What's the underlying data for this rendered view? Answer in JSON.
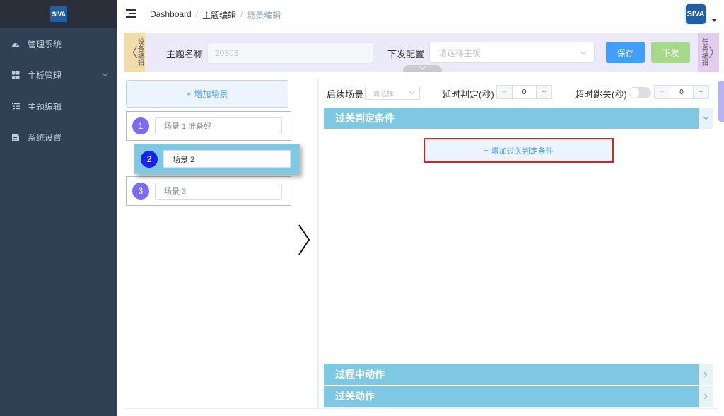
{
  "sidebar": {
    "logo_text": "SIVA",
    "items": [
      {
        "label": "管理系统",
        "icon": "dashboard-icon"
      },
      {
        "label": "主板管理",
        "icon": "grid-icon",
        "has_submenu": true
      },
      {
        "label": "主题编辑",
        "icon": "list-icon"
      },
      {
        "label": "系统设置",
        "icon": "document-icon"
      }
    ]
  },
  "navbar": {
    "breadcrumb": [
      "Dashboard",
      "主题编辑",
      "场景编辑"
    ],
    "avatar_text": "SIVA"
  },
  "theme_bar": {
    "left_tab": "设备编辑",
    "right_tab": "任务编辑",
    "theme_name_label": "主题名称",
    "theme_name_value": "20303",
    "config_label": "下发配置",
    "config_placeholder": "请选择主板",
    "save_label": "保存",
    "send_label": "下发"
  },
  "scenes": {
    "add_label": "增加场景",
    "items": [
      {
        "num": "1",
        "name": "场景 1 准备好",
        "color": "#7b6cf6"
      },
      {
        "num": "2",
        "name": "场景 2",
        "color": "#1a22f0"
      },
      {
        "num": "3",
        "name": "场景 3",
        "color": "#7b6cf6"
      }
    ]
  },
  "scene_settings": {
    "next_scene_label": "后续场景",
    "next_scene_placeholder": "请选择",
    "delay_label": "延时判定(秒)",
    "delay_value": "0",
    "timeout_label": "超时跳关(秒)",
    "timeout_value": "0",
    "minus": "−",
    "plus": "+"
  },
  "sections": {
    "condition_title": "过关判定条件",
    "add_condition_label": "增加过关判定条件",
    "process_title": "过程中动作",
    "pass_title": "过关动作"
  },
  "colors": {
    "sidebar_bg": "#304156",
    "primary": "#409eff",
    "section_header": "#7ec8e3",
    "highlight_border": "#e02020"
  }
}
